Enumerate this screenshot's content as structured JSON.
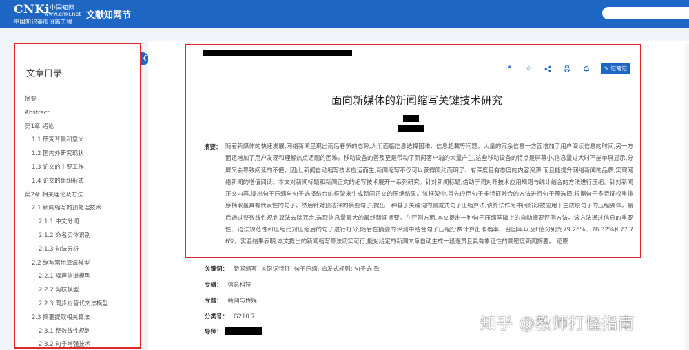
{
  "header": {
    "logo_main": "CNKi",
    "logo_cn": "中国知网",
    "logo_url": "www.cnki.net",
    "logo_subtitle": "中国知识基础设施工程",
    "site_name": "文献知网节"
  },
  "sidebar": {
    "title": "文章目录",
    "items": [
      {
        "label": "摘要",
        "level": 1
      },
      {
        "label": "Abstract",
        "level": 1
      },
      {
        "label": "第1章 绪论",
        "level": 1
      },
      {
        "label": "1.1 研究背景和意义",
        "level": 2
      },
      {
        "label": "1.2 国内外研究现状",
        "level": 2
      },
      {
        "label": "1.3 论文的主要工作",
        "level": 2
      },
      {
        "label": "1.4 论文的组织形式",
        "level": 2
      },
      {
        "label": "第2章 相关理论及方法",
        "level": 1
      },
      {
        "label": "2.1 新闻缩写的预处理技术",
        "level": 2
      },
      {
        "label": "2.1.1 中文分词",
        "level": 3
      },
      {
        "label": "2.1.2 命名实体识别",
        "level": 3
      },
      {
        "label": "2.1.3 句法分析",
        "level": 3
      },
      {
        "label": "2.2 缩写常用算法模型",
        "level": 2
      },
      {
        "label": "2.2.1 噪声信道模型",
        "level": 3
      },
      {
        "label": "2.2.2 剪枝模型",
        "level": 3
      },
      {
        "label": "2.2.3 同步树替代文法模型",
        "level": 3
      },
      {
        "label": "2.3 摘要提取相关算法",
        "level": 2
      },
      {
        "label": "2.3.1 整数线性规划",
        "level": 3
      },
      {
        "label": "2.3.2 句子增强技术",
        "level": 3
      }
    ]
  },
  "toolbar": {
    "icons": [
      "quote-icon",
      "star-icon",
      "share-icon",
      "print-icon",
      "bell-icon"
    ],
    "note_label": "记笔记"
  },
  "paper": {
    "title": "面向新媒体的新闻缩写关键技术研究",
    "abstract_label": "摘要：",
    "abstract": "随着新媒体的快速发展,网络新闻呈现出雨后春笋的态势,人们面临信息选择困难、信息超载等问题。大量的冗余信息一方面增加了用户阅读信息的时间,另一方面还增加了用户发现和理解热点话题的困难。移动设备的普及更是带动了新闻客户端的大量产生,这些移动设备的特点是屏幕小,信息量过大时不能单屏显示,分屏又会导致阅读的不便。因此,新闻自动缩写技术应运而生,新闻缩写不仅可以获得简约而明了、有深度且有态度的内容资源,而且能提升网络新闻的品质,实现网络新闻的增值阅读。本文对新闻标题和新闻正文的缩写技术展开一系列研究。针对新闻标题,借助于词对齐技术应用规则与统计结合的方法进行压缩。针对新闻正文内容,提出句子压缩与句子选择结合的框架来生成新闻正文的压缩结果。该框架中,首先应用句子多特征融合的方法进行句子预选择,根据句子多特征权重排序抽取最具有代表性的句子。然后针对预选择的摘要句子,提出一种基于关键词的删减式句子压缩算法,该算法作为中间阶段被应用于生成原句子的压缩变体。最后通过整数线性规划算法去除冗余,选取信息量最大的最终新闻摘要。在评测方面,本文提出一种句子压缩基础上的自动摘要评测方法。该方法通过信息的重要性、语法规范性和压缩比对压缩后的句子进行打分,随后在摘要的评测中结合句子压缩分数计算出准确率、召回率以及F值分别为79.26%、76.32%和77.76%。实验结果表明,本文提出的新闻缩写算法切实可行,能对给定的新闻文章自动生成一段连贯且具有象征性的高密度新闻摘要。 还原",
    "meta": [
      {
        "label": "关键词：",
        "value": "新闻缩写;  关键词特征;  句子压缩;  启发式规则;  句子选择;"
      },
      {
        "label": "专辑：",
        "value": "信息科技"
      },
      {
        "label": "专题：",
        "value": "新闻与传媒"
      },
      {
        "label": "分类号：",
        "value": "G210.7"
      },
      {
        "label": "导师：",
        "value": ""
      }
    ]
  },
  "watermark": "知乎 @教师打怪指南",
  "colors": {
    "header_blue": "#1e66c3",
    "highlight_red": "#e3262b"
  }
}
